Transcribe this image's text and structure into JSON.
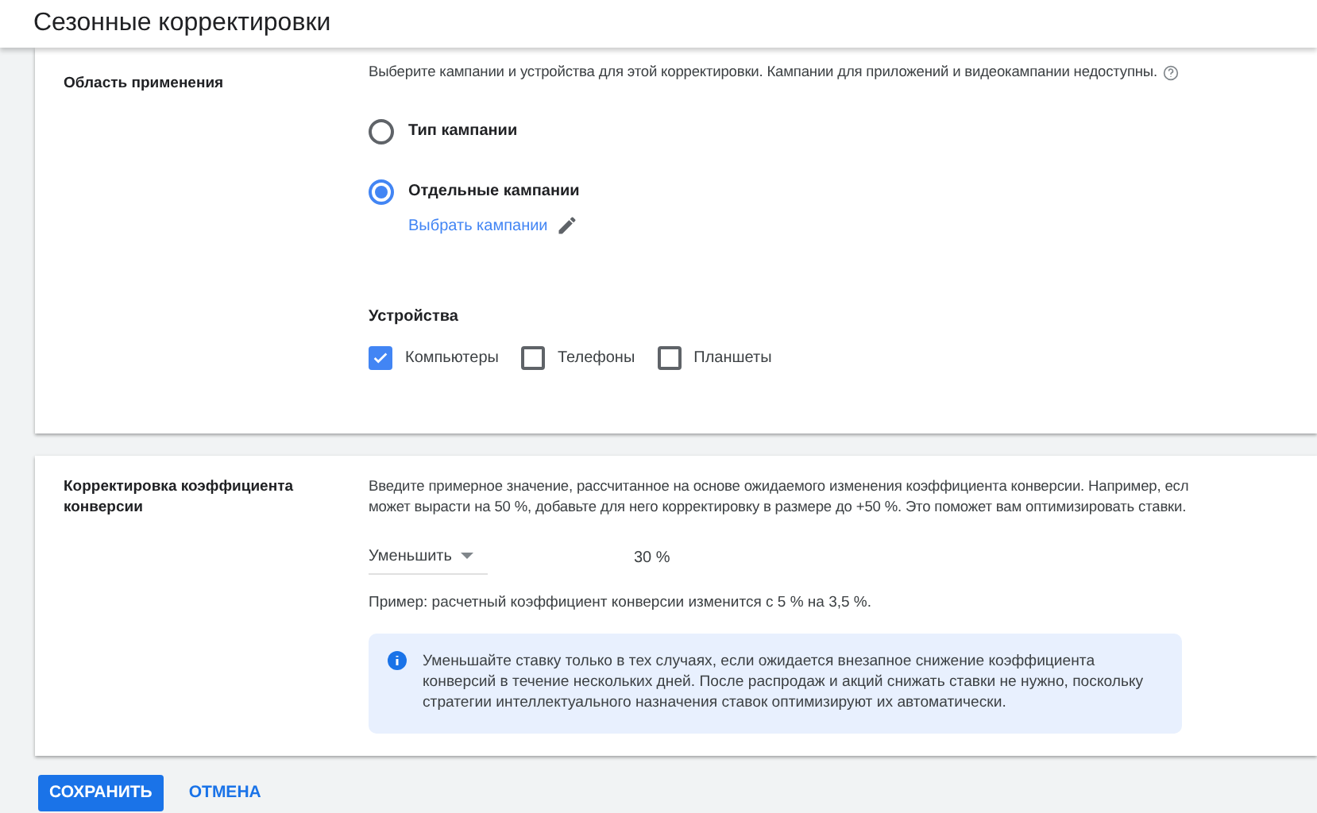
{
  "header": {
    "title": "Сезонные корректировки"
  },
  "scope": {
    "label": "Область применения",
    "description": "Выберите кампании и устройства для этой корректировки. Кампании для приложений и видеокампании недоступны.",
    "options": [
      {
        "label": "Тип кампании",
        "selected": false
      },
      {
        "label": "Отдельные кампании",
        "selected": true
      }
    ],
    "link": "Выбрать кампании",
    "devices_label": "Устройства",
    "devices": [
      {
        "label": "Компьютеры",
        "checked": true
      },
      {
        "label": "Телефоны",
        "checked": false
      },
      {
        "label": "Планшеты",
        "checked": false
      }
    ]
  },
  "conversion": {
    "label": "Корректировка коэффициента конверсии",
    "description_lines": [
      "Введите примерное значение, рассчитанное на основе ожидаемого изменения коэффициента конверсии. Например, есл",
      "может вырасти на 50 %, добавьте для него корректировку в размере до +50 %. Это поможет вам оптимизировать ставки."
    ],
    "direction": "Уменьшить",
    "value": "30 %",
    "example": "Пример: расчетный коэффициент конверсии изменится с 5 % на 3,5 %.",
    "info": "Уменьшайте ставку только в тех случаях, если ожидается внезапное снижение коэффициента конверсий в течение нескольких дней. После распродаж и акций снижать ставки не нужно, поскольку стратегии интеллектуального назначения ставок оптимизируют их автоматически."
  },
  "buttons": [
    {
      "label": "СОХРАНИТЬ",
      "kind": "primary"
    },
    {
      "label": "ОТМЕНА",
      "kind": "text"
    }
  ]
}
